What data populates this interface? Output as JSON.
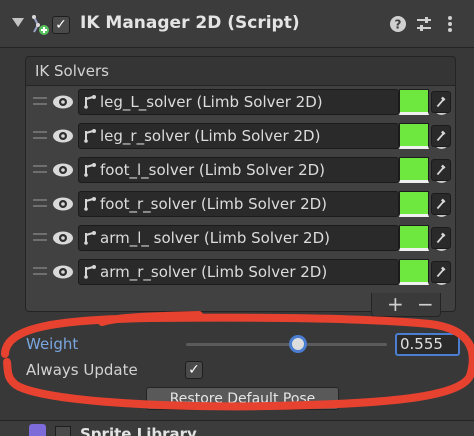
{
  "component": {
    "title": "IK Manager 2D (Script)",
    "enabled_mark": "✓"
  },
  "ik_solvers": {
    "title": "IK Solvers",
    "items": [
      {
        "label": "leg_L_solver (Limb Solver 2D)",
        "color": "#6ee83e"
      },
      {
        "label": "leg_r_solver (Limb Solver 2D)",
        "color": "#6ee83e"
      },
      {
        "label": "foot_l_solver (Limb Solver 2D)",
        "color": "#6ee83e"
      },
      {
        "label": "foot_r_solver (Limb Solver 2D)",
        "color": "#6ee83e"
      },
      {
        "label": "arm_l_ solver (Limb Solver 2D)",
        "color": "#6ee83e"
      },
      {
        "label": "arm_r_solver (Limb Solver 2D)",
        "color": "#6ee83e"
      }
    ],
    "add": "+",
    "remove": "−"
  },
  "weight": {
    "label": "Weight",
    "value": "0.555",
    "fraction": 0.555
  },
  "always_update": {
    "label": "Always Update",
    "mark": "✓"
  },
  "restore_button": "Restore Default Pose",
  "next_component": {
    "title": "Sprite Library"
  },
  "colors": {
    "accent": "#4b7dd1",
    "annotation": "#e6422f",
    "solver_color": "#6ee83e"
  }
}
